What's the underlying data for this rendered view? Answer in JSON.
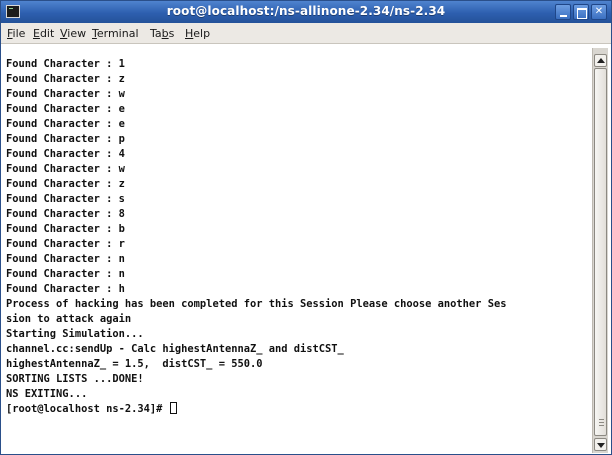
{
  "window": {
    "title": "root@localhost:/ns-allinone-2.34/ns-2.34"
  },
  "menu": {
    "items": [
      {
        "accel": "F",
        "rest": "ile"
      },
      {
        "accel": "E",
        "rest": "dit"
      },
      {
        "accel": "V",
        "rest": "iew"
      },
      {
        "accel": "T",
        "rest": "erminal"
      },
      {
        "pre": "Ta",
        "accel": "b",
        "rest": "s"
      },
      {
        "accel": "H",
        "rest": "elp"
      }
    ]
  },
  "terminal": {
    "lines": [
      "Found Character : 1",
      "Found Character : z",
      "Found Character : w",
      "Found Character : e",
      "Found Character : e",
      "Found Character : p",
      "Found Character : 4",
      "Found Character : w",
      "Found Character : z",
      "Found Character : s",
      "Found Character : 8",
      "Found Character : b",
      "Found Character : r",
      "Found Character : n",
      "Found Character : n",
      "Found Character : h",
      "Process of hacking has been completed for this Session Please choose another Ses",
      "sion to attack again",
      "Starting Simulation...",
      "channel.cc:sendUp - Calc highestAntennaZ_ and distCST_",
      "highestAntennaZ_ = 1.5,  distCST_ = 550.0",
      "SORTING LISTS ...DONE!",
      "NS EXITING...",
      "[root@localhost ns-2.34]# "
    ]
  },
  "colors": {
    "titlebar": "#2d5faf",
    "menubar": "#ece9e4",
    "terminal_bg": "#ffffff",
    "terminal_fg": "#101010"
  }
}
